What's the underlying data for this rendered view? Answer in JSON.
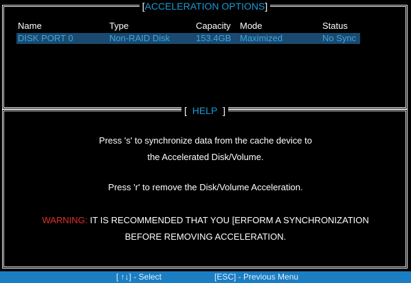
{
  "accel": {
    "title": "ACCELERATION OPTIONS",
    "headers": [
      "Name",
      "Type",
      "Capacity",
      "Mode",
      "Status"
    ],
    "rows": [
      [
        "DISK PORT 0",
        "Non-RAID Disk",
        "153.4GB",
        "Maximized",
        "No Sync"
      ]
    ]
  },
  "help": {
    "title": "HELP",
    "lines": [
      "Press 's' to synchronize data from the cache device to",
      "the Accelerated Disk/Volume.",
      "Press 'r' to remove the Disk/Volume Acceleration."
    ],
    "warning_label": "WARNING:",
    "warning_text": "IT IS RECOMMENDED THAT YOU [ERFORM A SYNCHRONIZATION",
    "warning_text2": "BEFORE REMOVING ACCELERATION."
  },
  "footer": {
    "select": "[ ↑↓] - Select",
    "esc": "[ESC] - Previous Menu"
  },
  "colors": {
    "accent": "#1a9ad6",
    "selected_row_bg": "#1a4a70",
    "warning": "#e0302a",
    "footer_bg": "#1b7dc2"
  }
}
